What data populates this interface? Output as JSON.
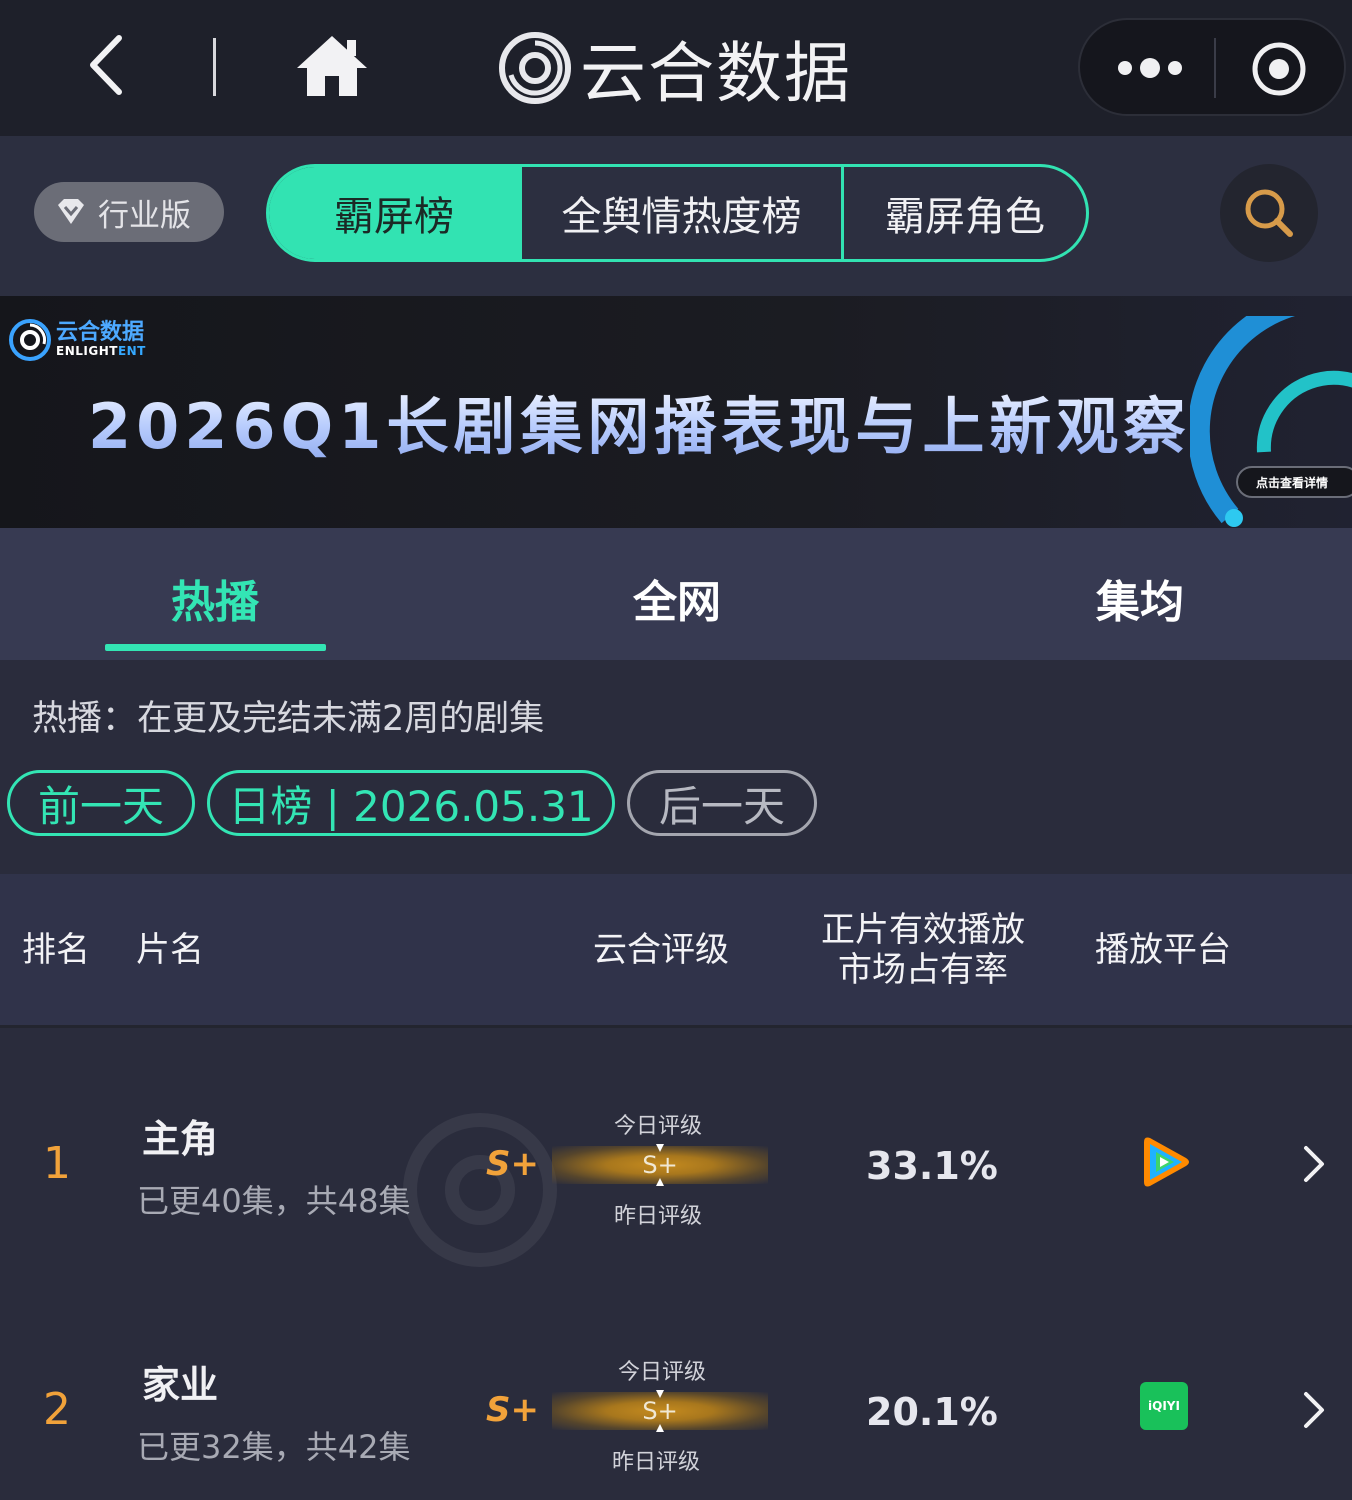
{
  "topbar": {
    "brand_title": "云合数据"
  },
  "filter": {
    "industry_badge": "行业版",
    "segments": [
      "霸屏榜",
      "全舆情热度榜",
      "霸屏角色"
    ]
  },
  "banner": {
    "logo_cn": "云合数据",
    "logo_en_a": "ENLIGHT",
    "logo_en_b": "ENT",
    "title": "2026Q1长剧集网播表现与上新观察",
    "detail_button": "点击查看详情"
  },
  "tabs": [
    "热播",
    "全网",
    "集均"
  ],
  "description": "热播：在更及完结未满2周的剧集",
  "date_controls": {
    "prev": "前一天",
    "current": "日榜 | 2026.05.31",
    "next": "后一天"
  },
  "table": {
    "headers": {
      "rank": "排名",
      "title": "片名",
      "grade": "云合评级",
      "share_line1": "正片有效播放",
      "share_line2": "市场占有率",
      "platform": "播放平台"
    },
    "rows": [
      {
        "rank": "1",
        "title": "主角",
        "episodes": "已更40集，共48集",
        "grade": "S+",
        "gauge_today_label": "今日评级",
        "gauge_value": "S+",
        "gauge_yesterday_label": "昨日评级",
        "share": "33.1%",
        "platform_icon": "tencent-video-icon"
      },
      {
        "rank": "2",
        "title": "家业",
        "episodes": "已更32集，共42集",
        "grade": "S+",
        "gauge_today_label": "今日评级",
        "gauge_value": "S+",
        "gauge_yesterday_label": "昨日评级",
        "share": "20.1%",
        "platform_icon": "iqiyi-icon",
        "platform_label": "iQIYI"
      }
    ]
  },
  "colors": {
    "accent": "#33e5b4",
    "rank_orange": "#f1a23a",
    "background": "#2a2c3c"
  }
}
